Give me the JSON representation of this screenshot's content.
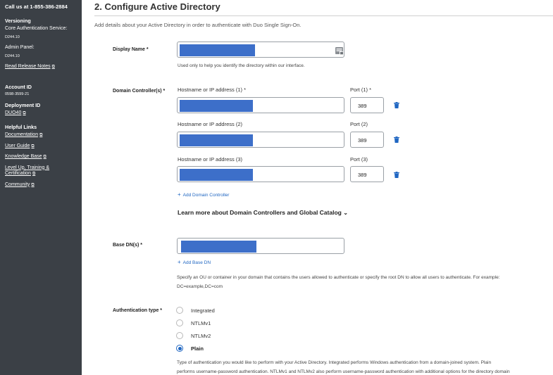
{
  "sidebar": {
    "call": "Call us at 1-855-386-2884",
    "versioning_heading": "Versioning",
    "core_service_label": "Core Authentication Service:",
    "core_service_version": "D244.10",
    "admin_panel_label": "Admin Panel:",
    "admin_panel_version": "D244.10",
    "release_notes": "Read Release Notes",
    "account_id_label": "Account ID",
    "account_id": "0598-3599-21",
    "deployment_id_label": "Deployment ID",
    "deployment_id": "DUO40",
    "helpful_links_heading": "Helpful Links",
    "links": [
      "Documentation",
      "User Guide",
      "Knowledge Base",
      "Level Up, Training &",
      "Certification",
      "Community"
    ]
  },
  "page": {
    "title": "2. Configure Active Directory",
    "intro": "Add details about your Active Directory in order to authenticate with Duo Single Sign-On."
  },
  "display_name": {
    "label": "Display Name *",
    "hint": "Used only to help you identify the directory within our interface."
  },
  "domain_controllers": {
    "label": "Domain Controller(s) *",
    "rows": [
      {
        "host_label": "Hostname or IP address (1) *",
        "port_label": "Port (1) *",
        "port_value": "389"
      },
      {
        "host_label": "Hostname or IP address (2)",
        "port_label": "Port (2)",
        "port_value": "389"
      },
      {
        "host_label": "Hostname or IP address (3)",
        "port_label": "Port (3)",
        "port_value": "389"
      }
    ],
    "add_label": "Add Domain Controller",
    "learn_more": "Learn more about Domain Controllers and Global Catalog"
  },
  "base_dn": {
    "label": "Base DN(s) *",
    "add_label": "Add Base DN",
    "desc_line1": "Specify an OU or container in your domain that contains the users allowed to authenticate or specify the root DN to allow all users to authenticate. For example:",
    "desc_line2": "DC=example,DC=com"
  },
  "auth_type": {
    "label": "Authentication type *",
    "options": [
      "Integrated",
      "NTLMv1",
      "NTLMv2",
      "Plain"
    ],
    "selected": "Plain",
    "desc_line1": "Type of authentication you would like to perform with your Active Directory. Integrated performs Windows authentication from a domain-joined system. Plain",
    "desc_line2": "performs username-password authentication. NTLMv1 and NTLMv2 also perform username-password authentication with additional options for the directory domain"
  },
  "colors": {
    "sidebar_bg": "#3b4046",
    "accent": "#1f66c2",
    "redaction": "#3d6fc9"
  },
  "icons": {
    "external": "external-link-icon",
    "trash": "trash-icon",
    "chevron": "chevron-down-icon",
    "plus": "plus-icon",
    "password_manager": "password-manager-icon"
  }
}
